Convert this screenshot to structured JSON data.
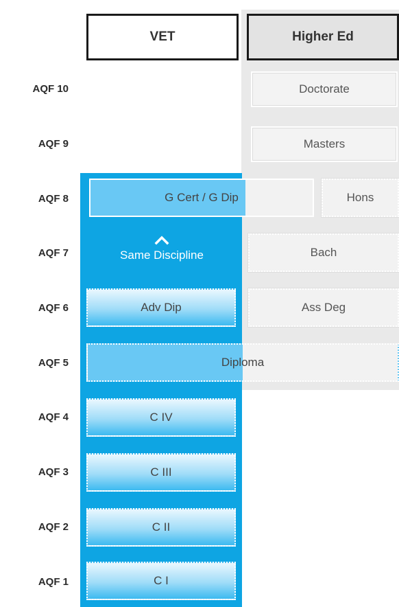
{
  "headers": {
    "vet": "VET",
    "higher_ed": "Higher Ed"
  },
  "levels": [
    "AQF 10",
    "AQF 9",
    "AQF 8",
    "AQF 7",
    "AQF 6",
    "AQF 5",
    "AQF 4",
    "AQF 3",
    "AQF 2",
    "AQF 1"
  ],
  "higher_ed": {
    "doctorate": "Doctorate",
    "masters": "Masters",
    "hons": "Hons",
    "bach": "Bach",
    "ass_deg": "Ass Deg"
  },
  "shared": {
    "gcert_gdip": "G Cert / G Dip",
    "diploma": "Diploma"
  },
  "pathway": {
    "label": "Same Discipline",
    "icon": "chevron-up-icon"
  },
  "vet": {
    "adv_dip": "Adv Dip",
    "c4": "C IV",
    "c3": "C III",
    "c2": "C II",
    "c1": "C I"
  },
  "colors": {
    "vet_band": "#0ea5e3",
    "higher_ed_band": "#e9e9e9",
    "header_border": "#1a1a1a"
  }
}
